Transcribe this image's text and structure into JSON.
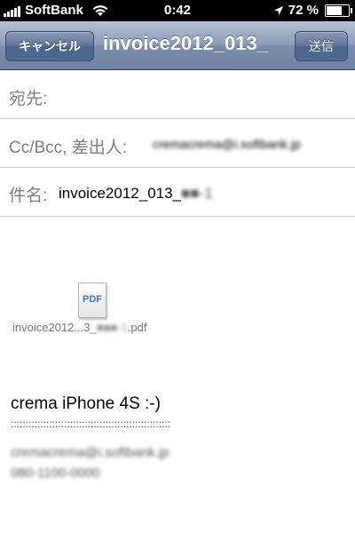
{
  "status_bar": {
    "carrier": "SoftBank",
    "time": "0:42",
    "battery": "72 %",
    "battery_level": 0.72,
    "icons": [
      "signal-bars-icon",
      "wifi-icon",
      "location-arrow-icon",
      "battery-icon"
    ]
  },
  "nav": {
    "cancel_label": "キャンセル",
    "title": "invoice2012_013_",
    "send_label": "送信"
  },
  "fields": {
    "to_label": "宛先:",
    "cc_label": "Cc/Bcc, 差出人:",
    "cc_value": "cremacrema@i.softbank.jp",
    "subject_label": "件名:",
    "subject_value": "invoice2012_013_",
    "subject_value_redacted": "■■-1"
  },
  "attachment": {
    "icon_text": "PDF",
    "name_prefix": "invoice2012...3_",
    "name_redacted": "■■■-1",
    "name_suffix": ".pdf"
  },
  "body": {
    "text": "crema iPhone 4S :-)",
    "separator": "::::::::::::::::::::::::::::::::::::::::::::::::::::::",
    "signature_line1": "cremacrema@i.softbank.jp",
    "signature_line2": "080-1100-0000"
  }
}
